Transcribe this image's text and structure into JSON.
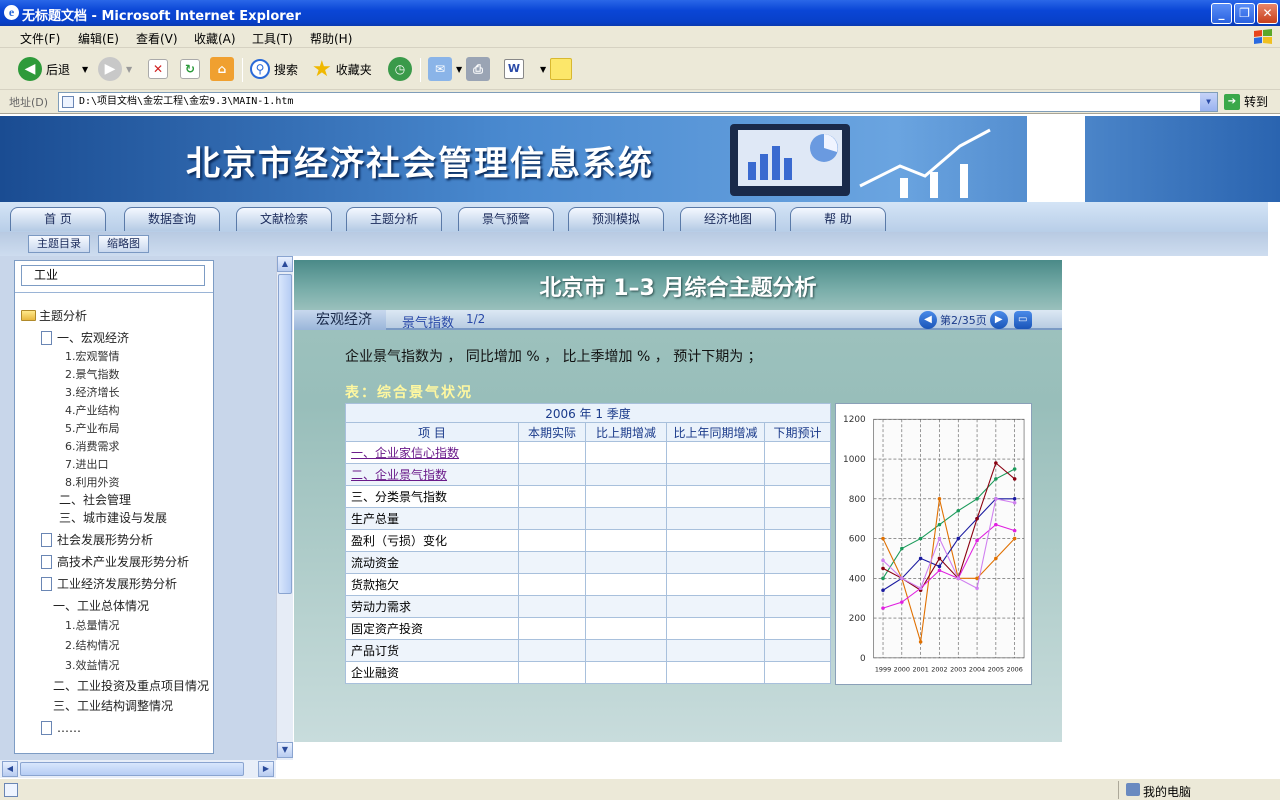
{
  "window": {
    "title": "无标题文档 - Microsoft Internet Explorer"
  },
  "menu": [
    "文件(F)",
    "编辑(E)",
    "查看(V)",
    "收藏(A)",
    "工具(T)",
    "帮助(H)"
  ],
  "toolbar": {
    "back": "后退",
    "search": "搜索",
    "favorites": "收藏夹"
  },
  "address": {
    "label": "地址(D)",
    "url": "D:\\项目文档\\金宏工程\\金宏9.3\\MAIN-1.htm",
    "go": "转到"
  },
  "banner": {
    "title": "北京市经济社会管理信息系统"
  },
  "nav": [
    "首  页",
    "数据查询",
    "文献检索",
    "主题分析",
    "景气预警",
    "预测模拟",
    "经济地图",
    "帮  助"
  ],
  "subnav": [
    "主题目录",
    "缩略图"
  ],
  "tree": {
    "search": "工业",
    "nodes": [
      {
        "text": "主题分析",
        "icon": "folder-icon"
      },
      {
        "text": "一、宏观经济",
        "icon": "page-icon"
      },
      {
        "text": "1.宏观警情"
      },
      {
        "text": "2.景气指数"
      },
      {
        "text": "3.经济增长"
      },
      {
        "text": "4.产业结构"
      },
      {
        "text": "5.产业布局"
      },
      {
        "text": "6.消费需求"
      },
      {
        "text": "7.进出口"
      },
      {
        "text": "8.利用外资"
      },
      {
        "text": "二、社会管理"
      },
      {
        "text": "三、城市建设与发展"
      },
      {
        "text": "社会发展形势分析",
        "icon": "page-icon"
      },
      {
        "text": "高技术产业发展形势分析",
        "icon": "page-icon"
      },
      {
        "text": "工业经济发展形势分析",
        "icon": "page-icon"
      },
      {
        "text": "一、工业总体情况"
      },
      {
        "text": "1.总量情况"
      },
      {
        "text": "2.结构情况"
      },
      {
        "text": "3.效益情况"
      },
      {
        "text": "二、工业投资及重点项目情况"
      },
      {
        "text": "三、工业结构调整情况"
      },
      {
        "text": "……",
        "icon": "page-icon"
      }
    ]
  },
  "main": {
    "header": "北京市 1–3 月综合主题分析",
    "tab1": "宏观经济",
    "tab2": "景气指数",
    "tab2_page": "1/2",
    "pager": "第2/35页",
    "summary": "企业景气指数为 ， 同比增加 % ， 比上季增加 % ， 预计下期为 ；",
    "table_caption": "表：综合景气状况",
    "table": {
      "period": "2006 年 1 季度",
      "headers": [
        "项        目",
        "本期实际",
        "比上期增减",
        "比上年同期增减",
        "下期预计"
      ],
      "rows": [
        "一、企业家信心指数",
        "二、企业景气指数",
        "三、分类景气指数",
        "生产总量",
        "盈利（亏损）变化",
        "流动资金",
        "货款拖欠",
        "劳动力需求",
        "固定资产投资",
        "产品订货",
        "企业融资"
      ]
    }
  },
  "statusbar": {
    "zone": "我的电脑"
  },
  "chart_data": {
    "type": "line",
    "categories": [
      "1999",
      "2000",
      "2001",
      "2002",
      "2003",
      "2004",
      "2005",
      "2006"
    ],
    "ylim": [
      0,
      1200
    ],
    "yticks": [
      0,
      200,
      400,
      600,
      800,
      1000,
      1200
    ],
    "grid": true,
    "series": [
      {
        "color": "#1a9a5a",
        "values": [
          400,
          550,
          600,
          670,
          740,
          800,
          900,
          950
        ]
      },
      {
        "color": "#e07000",
        "values": [
          600,
          400,
          80,
          800,
          400,
          400,
          500,
          600
        ]
      },
      {
        "color": "#1a1aa0",
        "values": [
          340,
          400,
          500,
          460,
          600,
          700,
          800,
          800
        ]
      },
      {
        "color": "#8a0010",
        "values": [
          450,
          400,
          340,
          500,
          400,
          700,
          980,
          900
        ]
      },
      {
        "color": "#e020e0",
        "values": [
          250,
          280,
          350,
          440,
          400,
          590,
          670,
          640
        ]
      },
      {
        "color": "#d080f0",
        "values": [
          490,
          400,
          350,
          600,
          400,
          350,
          800,
          780
        ]
      }
    ]
  }
}
